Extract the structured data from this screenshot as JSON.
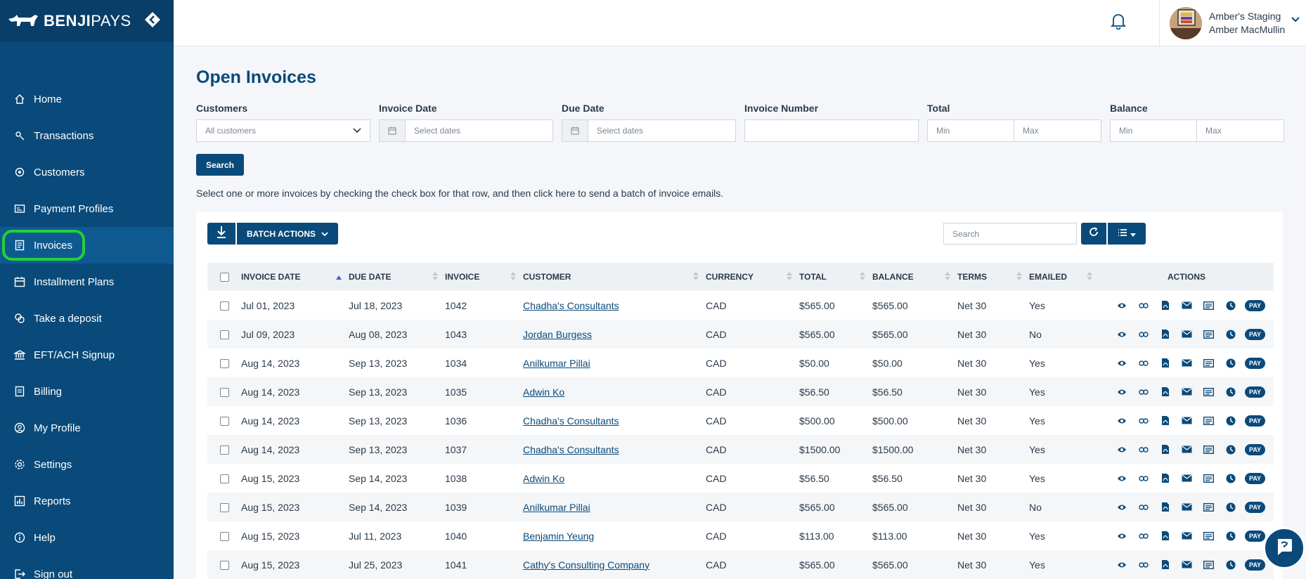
{
  "brand": {
    "name_bold": "BENJI",
    "name_light": "PAYS"
  },
  "sidebar": {
    "items": [
      {
        "label": "Home",
        "icon": "home-icon"
      },
      {
        "label": "Transactions",
        "icon": "transactions-icon"
      },
      {
        "label": "Customers",
        "icon": "customers-icon"
      },
      {
        "label": "Payment Profiles",
        "icon": "payment-profiles-icon"
      },
      {
        "label": "Invoices",
        "icon": "invoices-icon"
      },
      {
        "label": "Installment Plans",
        "icon": "calendar-icon"
      },
      {
        "label": "Take a deposit",
        "icon": "deposit-icon"
      },
      {
        "label": "EFT/ACH Signup",
        "icon": "bank-icon"
      },
      {
        "label": "Billing",
        "icon": "billing-icon"
      },
      {
        "label": "My Profile",
        "icon": "profile-icon"
      },
      {
        "label": "Settings",
        "icon": "gear-icon"
      },
      {
        "label": "Reports",
        "icon": "reports-icon"
      },
      {
        "label": "Help",
        "icon": "info-icon"
      },
      {
        "label": "Sign out",
        "icon": "sign-out-icon"
      }
    ]
  },
  "header": {
    "account_name": "Amber's Staging",
    "user_name": "Amber MacMullin"
  },
  "page": {
    "title": "Open Invoices",
    "hint": "Select one or more invoices by checking the check box for that row, and then click here to send a batch of invoice emails."
  },
  "filters": {
    "customers_label": "Customers",
    "customers_value": "All customers",
    "invoice_date_label": "Invoice Date",
    "invoice_date_placeholder": "Select dates",
    "due_date_label": "Due Date",
    "due_date_placeholder": "Select dates",
    "invoice_number_label": "Invoice Number",
    "total_label": "Total",
    "balance_label": "Balance",
    "min_placeholder": "Min",
    "max_placeholder": "Max",
    "search_label": "Search"
  },
  "table_toolbar": {
    "batch_actions_label": "BATCH ACTIONS",
    "search_placeholder": "Search"
  },
  "table": {
    "columns": [
      "INVOICE DATE",
      "DUE DATE",
      "INVOICE",
      "CUSTOMER",
      "CURRENCY",
      "TOTAL",
      "BALANCE",
      "TERMS",
      "EMAILED",
      "ACTIONS"
    ],
    "pay_label": "PAY",
    "rows": [
      {
        "invoice_date": "Jul 01, 2023",
        "due_date": "Jul 18, 2023",
        "invoice": "1042",
        "customer": "Chadha's Consultants",
        "currency": "CAD",
        "total": "$565.00",
        "balance": "$565.00",
        "terms": "Net 30",
        "emailed": "Yes"
      },
      {
        "invoice_date": "Jul 09, 2023",
        "due_date": "Aug 08, 2023",
        "invoice": "1043",
        "customer": "Jordan Burgess",
        "currency": "CAD",
        "total": "$565.00",
        "balance": "$565.00",
        "terms": "Net 30",
        "emailed": "No"
      },
      {
        "invoice_date": "Aug 14, 2023",
        "due_date": "Sep 13, 2023",
        "invoice": "1034",
        "customer": "Anilkumar Pillai",
        "currency": "CAD",
        "total": "$50.00",
        "balance": "$50.00",
        "terms": "Net 30",
        "emailed": "Yes"
      },
      {
        "invoice_date": "Aug 14, 2023",
        "due_date": "Sep 13, 2023",
        "invoice": "1035",
        "customer": "Adwin Ko",
        "currency": "CAD",
        "total": "$56.50",
        "balance": "$56.50",
        "terms": "Net 30",
        "emailed": "Yes"
      },
      {
        "invoice_date": "Aug 14, 2023",
        "due_date": "Sep 13, 2023",
        "invoice": "1036",
        "customer": "Chadha's Consultants",
        "currency": "CAD",
        "total": "$500.00",
        "balance": "$500.00",
        "terms": "Net 30",
        "emailed": "Yes"
      },
      {
        "invoice_date": "Aug 14, 2023",
        "due_date": "Sep 13, 2023",
        "invoice": "1037",
        "customer": "Chadha's Consultants",
        "currency": "CAD",
        "total": "$1500.00",
        "balance": "$1500.00",
        "terms": "Net 30",
        "emailed": "Yes"
      },
      {
        "invoice_date": "Aug 15, 2023",
        "due_date": "Sep 14, 2023",
        "invoice": "1038",
        "customer": "Adwin Ko",
        "currency": "CAD",
        "total": "$56.50",
        "balance": "$56.50",
        "terms": "Net 30",
        "emailed": "Yes"
      },
      {
        "invoice_date": "Aug 15, 2023",
        "due_date": "Sep 14, 2023",
        "invoice": "1039",
        "customer": "Anilkumar Pillai",
        "currency": "CAD",
        "total": "$565.00",
        "balance": "$565.00",
        "terms": "Net 30",
        "emailed": "No"
      },
      {
        "invoice_date": "Aug 15, 2023",
        "due_date": "Jul 11, 2023",
        "invoice": "1040",
        "customer": "Benjamin Yeung",
        "currency": "CAD",
        "total": "$113.00",
        "balance": "$113.00",
        "terms": "Net 30",
        "emailed": "Yes"
      },
      {
        "invoice_date": "Aug 15, 2023",
        "due_date": "Jul 25, 2023",
        "invoice": "1041",
        "customer": "Cathy's Consulting Company",
        "currency": "CAD",
        "total": "$565.00",
        "balance": "$565.00",
        "terms": "Net 30",
        "emailed": "Yes"
      }
    ]
  },
  "colors": {
    "sidebar": "#0a4a7a",
    "accent": "#0a4a7a",
    "highlight": "#22d03a"
  }
}
